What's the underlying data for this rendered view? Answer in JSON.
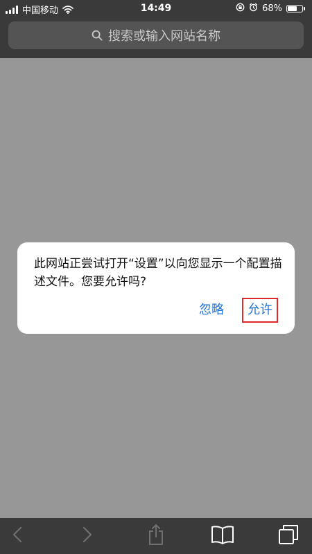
{
  "status_bar": {
    "carrier": "中国移动",
    "time": "14:49",
    "battery": "68%",
    "battery_level": 0.68
  },
  "url_bar": {
    "placeholder": "搜索或输入网站名称",
    "icon": "search-icon"
  },
  "dialog": {
    "message": "此网站正尝试打开“设置”以向您显示一个配置描述文件。您要允许吗?",
    "ignore_label": "忽略",
    "allow_label": "允许"
  },
  "toolbar": {
    "icons": [
      "back-icon",
      "forward-icon",
      "share-icon",
      "bookmarks-icon",
      "tabs-icon"
    ]
  },
  "colors": {
    "accent": "#1f73d6",
    "highlight": "#e0292b",
    "bars": "#3a3a3a",
    "page_dim": "#979797"
  }
}
